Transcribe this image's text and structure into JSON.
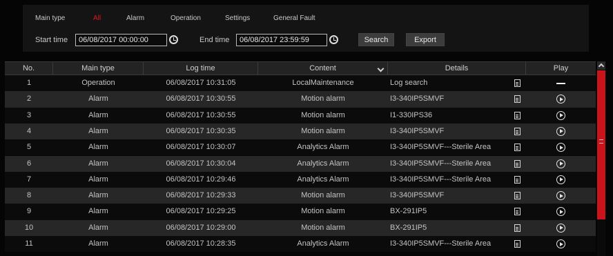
{
  "filter": {
    "main_type_label": "Main type",
    "types": [
      {
        "label": "All",
        "active": true
      },
      {
        "label": "Alarm",
        "active": false
      },
      {
        "label": "Operation",
        "active": false
      },
      {
        "label": "Settings",
        "active": false
      },
      {
        "label": "General Fault",
        "active": false
      }
    ],
    "start_time_label": "Start time",
    "start_time_value": "06/08/2017 00:00:00",
    "end_time_label": "End time",
    "end_time_value": "06/08/2017 23:59:59",
    "search_label": "Search",
    "export_label": "Export"
  },
  "colors": {
    "accent": "#e11b1b",
    "scrollbar": "#c8141a"
  },
  "table": {
    "headers": {
      "no": "No.",
      "main_type": "Main type",
      "log_time": "Log time",
      "content": "Content",
      "details": "Details",
      "play": "Play"
    },
    "rows": [
      {
        "no": "1",
        "main_type": "Operation",
        "log_time": "06/08/2017 10:31:05",
        "content": "LocalMaintenance",
        "details": "Log search",
        "play": "dash-icon"
      },
      {
        "no": "2",
        "main_type": "Alarm",
        "log_time": "06/08/2017 10:30:55",
        "content": "Motion alarm",
        "details": "I3-340IP5SMVF",
        "play": "play-icon"
      },
      {
        "no": "3",
        "main_type": "Alarm",
        "log_time": "06/08/2017 10:30:55",
        "content": "Motion alarm",
        "details": "I1-330IPS36",
        "play": "play-icon"
      },
      {
        "no": "4",
        "main_type": "Alarm",
        "log_time": "06/08/2017 10:30:35",
        "content": "Motion alarm",
        "details": "I3-340IP5SMVF",
        "play": "play-icon"
      },
      {
        "no": "5",
        "main_type": "Alarm",
        "log_time": "06/08/2017 10:30:07",
        "content": "Analytics Alarm",
        "details": "I3-340IP5SMVF---Sterile Area",
        "play": "play-icon"
      },
      {
        "no": "6",
        "main_type": "Alarm",
        "log_time": "06/08/2017 10:30:04",
        "content": "Analytics Alarm",
        "details": "I3-340IP5SMVF---Sterile Area",
        "play": "play-icon"
      },
      {
        "no": "7",
        "main_type": "Alarm",
        "log_time": "06/08/2017 10:29:46",
        "content": "Analytics Alarm",
        "details": "I3-340IP5SMVF---Sterile Area",
        "play": "play-icon"
      },
      {
        "no": "8",
        "main_type": "Alarm",
        "log_time": "06/08/2017 10:29:33",
        "content": "Motion alarm",
        "details": "I3-340IP5SMVF",
        "play": "play-icon"
      },
      {
        "no": "9",
        "main_type": "Alarm",
        "log_time": "06/08/2017 10:29:25",
        "content": "Motion alarm",
        "details": "BX-291IP5",
        "play": "play-icon"
      },
      {
        "no": "10",
        "main_type": "Alarm",
        "log_time": "06/08/2017 10:29:00",
        "content": "Motion alarm",
        "details": "BX-291IP5",
        "play": "play-icon"
      },
      {
        "no": "11",
        "main_type": "Alarm",
        "log_time": "06/08/2017 10:28:35",
        "content": "Analytics Alarm",
        "details": "I3-340IP5SMVF---Sterile Area",
        "play": "play-icon"
      }
    ]
  }
}
